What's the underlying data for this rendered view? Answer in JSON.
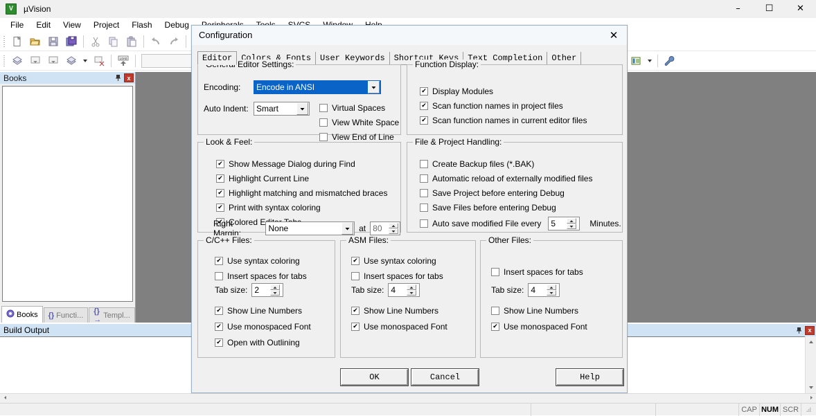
{
  "window": {
    "title": "µVision",
    "app_icon": "uvision-logo-icon",
    "minimize": "–",
    "maximize": "☐",
    "close": "✕"
  },
  "menubar": {
    "items": [
      {
        "label": "File"
      },
      {
        "label": "Edit"
      },
      {
        "label": "View"
      },
      {
        "label": "Project"
      },
      {
        "label": "Flash"
      },
      {
        "label": "Debug"
      },
      {
        "label": "Peripherals"
      },
      {
        "label": "Tools"
      },
      {
        "label": "SVCS"
      },
      {
        "label": "Window"
      },
      {
        "label": "Help"
      }
    ]
  },
  "toolbar": {
    "row1": [
      {
        "name": "new-file-icon",
        "glyph": "⬜"
      },
      {
        "name": "open-file-icon",
        "glyph": "📂"
      },
      {
        "name": "save-icon",
        "glyph": "💾"
      },
      {
        "name": "save-all-icon",
        "glyph": "🖫"
      },
      {
        "name": "cut-icon",
        "glyph": "✂"
      },
      {
        "name": "copy-icon",
        "glyph": "⧉"
      },
      {
        "name": "paste-icon",
        "glyph": "📋"
      },
      {
        "name": "undo-icon",
        "glyph": "↶"
      },
      {
        "name": "redo-icon",
        "glyph": "↷"
      },
      {
        "name": "navigate-back-icon",
        "glyph": "←"
      }
    ],
    "row2": [
      {
        "name": "bookmark-icon",
        "glyph": "⧉"
      },
      {
        "name": "build-icon",
        "glyph": "⬚"
      },
      {
        "name": "rebuild-icon",
        "glyph": "⬚"
      },
      {
        "name": "batch-build-icon",
        "glyph": "⧉"
      },
      {
        "name": "batch-build-dropdown-icon",
        "glyph": "▾"
      },
      {
        "name": "stop-build-icon",
        "glyph": "⬚"
      },
      {
        "name": "load-icon",
        "glyph": "LOAD"
      }
    ],
    "right": [
      {
        "name": "target-options-icon",
        "glyph": "☰"
      },
      {
        "name": "target-dropdown-icon",
        "glyph": "▾"
      },
      {
        "name": "configuration-wrench-icon",
        "glyph": "🔧"
      }
    ]
  },
  "books_panel": {
    "title": "Books",
    "pin_icon": "pin-icon",
    "close_icon": "x",
    "tabs": [
      {
        "label": "Books",
        "icon": "books-icon",
        "active": true
      },
      {
        "label": "Functi...",
        "icon": "{}",
        "active": false
      },
      {
        "label": "Templ...",
        "icon": "{}→",
        "active": false
      }
    ]
  },
  "build_output": {
    "title": "Build Output",
    "pin_icon": "pin-icon",
    "close_icon": "x"
  },
  "statusbar": {
    "cells": [
      "",
      "",
      ""
    ],
    "indicators": [
      {
        "label": "CAP",
        "active": false
      },
      {
        "label": "NUM",
        "active": true
      },
      {
        "label": "SCR",
        "active": false
      }
    ]
  },
  "dialog": {
    "title": "Configuration",
    "close_icon": "✕",
    "tabs": [
      {
        "label": "Editor",
        "active": true
      },
      {
        "label": "Colors & Fonts",
        "active": false
      },
      {
        "label": "User Keywords",
        "active": false
      },
      {
        "label": "Shortcut Keys",
        "active": false
      },
      {
        "label": "Text Completion",
        "active": false
      },
      {
        "label": "Other",
        "active": false
      }
    ],
    "general_editor_settings": {
      "legend": "General Editor Settings:",
      "encoding_label": "Encoding:",
      "encoding_value": "Encode in ANSI",
      "auto_indent_label": "Auto Indent:",
      "auto_indent_value": "Smart",
      "checkboxes": [
        {
          "label": "Virtual Spaces",
          "checked": false
        },
        {
          "label": "View White Space",
          "checked": false
        },
        {
          "label": "View End of Line",
          "checked": false
        }
      ]
    },
    "function_display": {
      "legend": "Function Display:",
      "checkboxes": [
        {
          "label": "Display Modules",
          "checked": true
        },
        {
          "label": "Scan function names in project files",
          "checked": true
        },
        {
          "label": "Scan function names in current editor files",
          "checked": true
        }
      ]
    },
    "look_and_feel": {
      "legend": "Look & Feel:",
      "checkboxes": [
        {
          "label": "Show Message Dialog during Find",
          "checked": true
        },
        {
          "label": "Highlight Current Line",
          "checked": true
        },
        {
          "label": "Highlight matching and mismatched braces",
          "checked": true
        },
        {
          "label": "Print with syntax coloring",
          "checked": true
        },
        {
          "label": "Colored Editor Tabs",
          "checked": true
        }
      ],
      "right_margin_label": "Right Margin:",
      "right_margin_value": "None",
      "at_label": "at",
      "at_value": "80"
    },
    "file_project_handling": {
      "legend": "File & Project Handling:",
      "checkboxes": [
        {
          "label": "Create Backup files (*.BAK)",
          "checked": false
        },
        {
          "label": "Automatic reload of externally modified files",
          "checked": false
        },
        {
          "label": "Save Project before entering Debug",
          "checked": false
        },
        {
          "label": "Save Files before entering Debug",
          "checked": false
        }
      ],
      "autosave_label": "Auto save modified File every",
      "autosave_checked": false,
      "autosave_value": "5",
      "minutes_label": "Minutes."
    },
    "c_files": {
      "legend": "C/C++ Files:",
      "checkboxes_top": [
        {
          "label": "Use syntax coloring",
          "checked": true
        },
        {
          "label": "Insert spaces for tabs",
          "checked": false
        }
      ],
      "tab_size_label": "Tab size:",
      "tab_size_value": "2",
      "checkboxes_bottom": [
        {
          "label": "Show Line Numbers",
          "checked": true
        },
        {
          "label": "Use monospaced Font",
          "checked": true
        },
        {
          "label": "Open with Outlining",
          "checked": true
        }
      ]
    },
    "asm_files": {
      "legend": "ASM Files:",
      "checkboxes_top": [
        {
          "label": "Use syntax coloring",
          "checked": true
        },
        {
          "label": "Insert spaces for tabs",
          "checked": false
        }
      ],
      "tab_size_label": "Tab size:",
      "tab_size_value": "4",
      "checkboxes_bottom": [
        {
          "label": "Show Line Numbers",
          "checked": true
        },
        {
          "label": "Use monospaced Font",
          "checked": true
        }
      ]
    },
    "other_files": {
      "legend": "Other Files:",
      "checkboxes_top": [
        {
          "label": "Insert spaces for tabs",
          "checked": false
        }
      ],
      "tab_size_label": "Tab size:",
      "tab_size_value": "4",
      "checkboxes_bottom": [
        {
          "label": "Show Line Numbers",
          "checked": false
        },
        {
          "label": "Use monospaced Font",
          "checked": true
        }
      ]
    },
    "buttons": {
      "ok": "OK",
      "cancel": "Cancel",
      "help": "Help"
    }
  },
  "colors": {
    "accent_selection": "#0a64c8",
    "panel_header": "#cfe3f5",
    "close_red": "#c0392b",
    "editor_background": "#808080"
  }
}
